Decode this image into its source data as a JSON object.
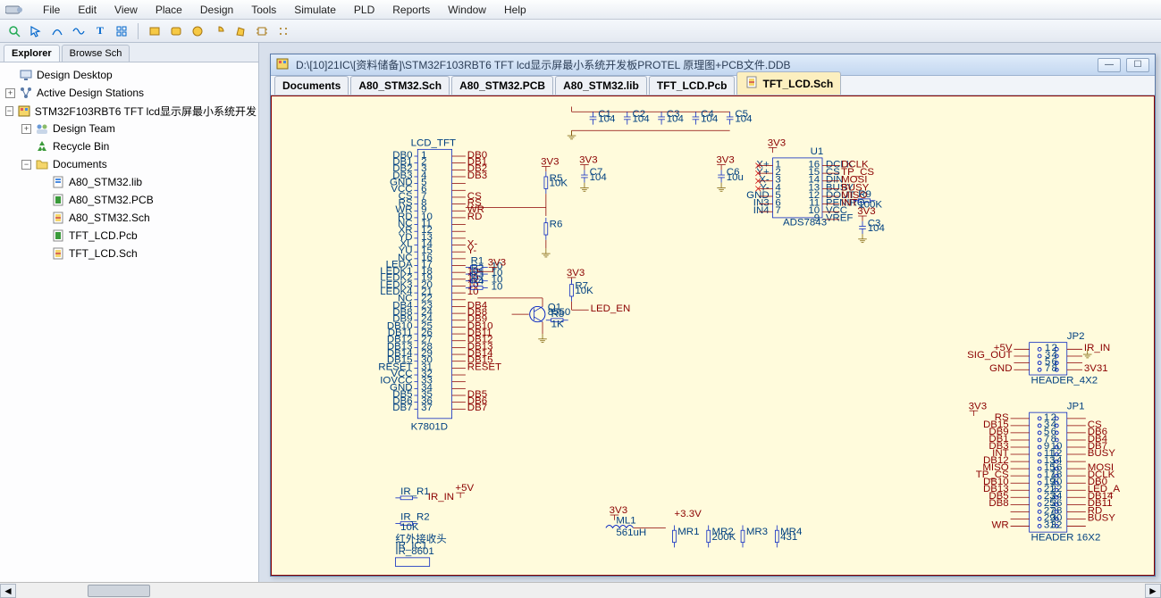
{
  "menu": {
    "items": [
      "File",
      "Edit",
      "View",
      "Place",
      "Design",
      "Tools",
      "Simulate",
      "PLD",
      "Reports",
      "Window",
      "Help"
    ]
  },
  "sidebar": {
    "tabs": [
      "Explorer",
      "Browse Sch"
    ],
    "active_tab": 0,
    "tree": [
      {
        "depth": 0,
        "exp": null,
        "icon": "desktop",
        "label": "Design Desktop"
      },
      {
        "depth": 0,
        "exp": "+",
        "icon": "stations",
        "label": "Active Design Stations"
      },
      {
        "depth": 0,
        "exp": "-",
        "icon": "ddb",
        "label": "STM32F103RBT6 TFT lcd显示屏最小系统开发"
      },
      {
        "depth": 1,
        "exp": "+",
        "icon": "team",
        "label": "Design Team"
      },
      {
        "depth": 1,
        "exp": null,
        "icon": "recycle",
        "label": "Recycle Bin"
      },
      {
        "depth": 1,
        "exp": "-",
        "icon": "folder",
        "label": "Documents"
      },
      {
        "depth": 2,
        "exp": null,
        "icon": "lib",
        "label": "A80_STM32.lib"
      },
      {
        "depth": 2,
        "exp": null,
        "icon": "pcb",
        "label": "A80_STM32.PCB"
      },
      {
        "depth": 2,
        "exp": null,
        "icon": "sch",
        "label": "A80_STM32.Sch"
      },
      {
        "depth": 2,
        "exp": null,
        "icon": "pcb",
        "label": "TFT_LCD.Pcb"
      },
      {
        "depth": 2,
        "exp": null,
        "icon": "sch",
        "label": "TFT_LCD.Sch"
      }
    ]
  },
  "doc": {
    "title": "D:\\[10]21IC\\[资料储备]\\STM32F103RBT6 TFT lcd显示屏最小系统开发板PROTEL 原理图+PCB文件.DDB",
    "tabs": [
      {
        "label": "Documents",
        "active": false
      },
      {
        "label": "A80_STM32.Sch",
        "active": false
      },
      {
        "label": "A80_STM32.PCB",
        "active": false
      },
      {
        "label": "A80_STM32.lib",
        "active": false
      },
      {
        "label": "TFT_LCD.Pcb",
        "active": false
      },
      {
        "label": "TFT_LCD.Sch",
        "active": true
      }
    ]
  },
  "sch": {
    "rail": "3V3",
    "rail5v": "+5V",
    "rail33": "+3.3V",
    "rail3v31": "3V31",
    "caps_top": [
      {
        "ref": "C1",
        "val": "104"
      },
      {
        "ref": "C2",
        "val": "104"
      },
      {
        "ref": "C3",
        "val": "104"
      },
      {
        "ref": "C4",
        "val": "104"
      },
      {
        "ref": "C5",
        "val": "104"
      }
    ],
    "c7": {
      "ref": "C7",
      "val": "104"
    },
    "c6": {
      "ref": "C6",
      "val": "10u"
    },
    "c3b": {
      "ref": "C3",
      "val": "104"
    },
    "r5": {
      "ref": "R5",
      "val": "10K"
    },
    "r6": {
      "ref": "R6",
      "val": ""
    },
    "r7": {
      "ref": "R7",
      "val": "10K"
    },
    "r8": {
      "ref": "R8",
      "val": "1K"
    },
    "r9": {
      "ref": "R9",
      "val": "100K"
    },
    "q1": {
      "ref": "Q1",
      "val": "8550"
    },
    "net_led": "LED_EN",
    "lcd_title": "LCD_TFT",
    "lcd_ref": "K7801D",
    "lcd_pins": [
      [
        "DB0",
        "1",
        "DB0"
      ],
      [
        "DB1",
        "2",
        "DB1"
      ],
      [
        "DB2",
        "3",
        "DB2"
      ],
      [
        "DB3",
        "4",
        "DB3"
      ],
      [
        "GND",
        "5",
        ""
      ],
      [
        "VCC",
        "6",
        ""
      ],
      [
        "CS",
        "7",
        "CS"
      ],
      [
        "RS",
        "8",
        "RS"
      ],
      [
        "WR",
        "9",
        "WR"
      ],
      [
        "RD",
        "10",
        "RD"
      ],
      [
        "NC",
        "11",
        ""
      ],
      [
        "XR",
        "12",
        ""
      ],
      [
        "YD",
        "13",
        ""
      ],
      [
        "XL",
        "14",
        "X-"
      ],
      [
        "YU",
        "15",
        "Y-"
      ],
      [
        "NC",
        "16",
        ""
      ],
      [
        "LEDA",
        "17",
        ""
      ],
      [
        "LEDK1",
        "18",
        "10"
      ],
      [
        "LEDK2",
        "19",
        "10"
      ],
      [
        "LEDK3",
        "20",
        "10"
      ],
      [
        "LEDK4",
        "21",
        "10"
      ],
      [
        "NC",
        "22",
        ""
      ],
      [
        "DB4",
        "23",
        "DB4"
      ],
      [
        "DB8",
        "24",
        "DB8"
      ],
      [
        "DB9",
        "24",
        "DB9"
      ],
      [
        "DB10",
        "25",
        "DB10"
      ],
      [
        "DB11",
        "26",
        "DB11"
      ],
      [
        "DB12",
        "27",
        "DB12"
      ],
      [
        "DB13",
        "28",
        "DB13"
      ],
      [
        "DB14",
        "29",
        "DB14"
      ],
      [
        "DB15",
        "30",
        "DB15"
      ],
      [
        "RESET",
        "31",
        "RESET"
      ],
      [
        "VCC",
        "32",
        ""
      ],
      [
        "IOVCC",
        "33",
        ""
      ],
      [
        "GND",
        "34",
        ""
      ],
      [
        "DB5",
        "35",
        "DB5"
      ],
      [
        "DB6",
        "36",
        "DB6"
      ],
      [
        "DB7",
        "37",
        "DB7"
      ]
    ],
    "leds_r": [
      {
        "ref": "R1",
        "val": "10"
      },
      {
        "ref": "R2",
        "val": "10"
      },
      {
        "ref": "R3",
        "val": "10"
      },
      {
        "ref": "R4",
        "val": "10"
      }
    ],
    "u1": {
      "ref": "U1",
      "part": "ADS7843",
      "left": [
        [
          "X+",
          "1"
        ],
        [
          "Y+",
          "2"
        ],
        [
          "X-",
          "3"
        ],
        [
          "Y-",
          "4"
        ],
        [
          "GND",
          "5"
        ],
        [
          "IN3",
          "6"
        ],
        [
          "IN4",
          "7"
        ]
      ],
      "right": [
        [
          "DCLK",
          "16",
          "DCLK"
        ],
        [
          "CS",
          "15",
          "TP_CS"
        ],
        [
          "DIN",
          "14",
          "MOSI"
        ],
        [
          "BUSY",
          "13",
          "BUSY"
        ],
        [
          "DOUT",
          "12",
          "MISO"
        ],
        [
          "PENIRQ",
          "11",
          "INT"
        ],
        [
          "VCC",
          "10",
          ""
        ],
        [
          "VREF",
          "9",
          ""
        ]
      ]
    },
    "jp2": {
      "ref": "JP2",
      "part": "HEADER_4X2",
      "nets_l": [
        "+5V",
        "SIG_OUT",
        "",
        "GND"
      ],
      "nets_r": [
        "IR_IN",
        "",
        "",
        "3V31"
      ],
      "pins": [
        [
          "1",
          "2"
        ],
        [
          "3",
          "4"
        ],
        [
          "5",
          "6"
        ],
        [
          "7",
          "8"
        ]
      ]
    },
    "jp1": {
      "ref": "JP1",
      "part": "HEADER 16X2",
      "nets_l": [
        "RS",
        "DB15",
        "DB9",
        "DB1",
        "DB3",
        "INT",
        "DB12",
        "MISO",
        "TP_CS",
        "DB10",
        "DB13",
        "DB5",
        "DB8",
        "",
        "",
        "WR"
      ],
      "nets_r": [
        "",
        "CS",
        "DB6",
        "DB4",
        "DB7",
        "BUSY",
        "",
        "MOSI",
        "DCLK",
        "DB0",
        "LED_A",
        "DB14",
        "DB11",
        "RD",
        "BUSY",
        ""
      ],
      "pins": [
        [
          "1",
          "2"
        ],
        [
          "3",
          "4"
        ],
        [
          "5",
          "6"
        ],
        [
          "7",
          "8"
        ],
        [
          "9",
          "10"
        ],
        [
          "11",
          "12"
        ],
        [
          "13",
          "14"
        ],
        [
          "15",
          "16"
        ],
        [
          "17",
          "18"
        ],
        [
          "19",
          "20"
        ],
        [
          "21",
          "22"
        ],
        [
          "23",
          "24"
        ],
        [
          "25",
          "26"
        ],
        [
          "27",
          "28"
        ],
        [
          "29",
          "30"
        ],
        [
          "31",
          "32"
        ]
      ]
    },
    "ir": {
      "r1": {
        "ref": "IR_R1",
        "val": ""
      },
      "r2": {
        "ref": "IR_R2",
        "val": "10K"
      },
      "net": "IR_IN",
      "ic": {
        "ref": "IR_IC1",
        "part": "IR_8601",
        "label": "红外接收头"
      }
    },
    "ml1": {
      "ref": "ML1",
      "val": "561uH"
    },
    "mr": [
      {
        "ref": "MR1",
        "val": ""
      },
      {
        "ref": "MR2",
        "val": "200K"
      },
      {
        "ref": "MR3",
        "val": ""
      },
      {
        "ref": "MR4",
        "val": "431"
      }
    ]
  }
}
